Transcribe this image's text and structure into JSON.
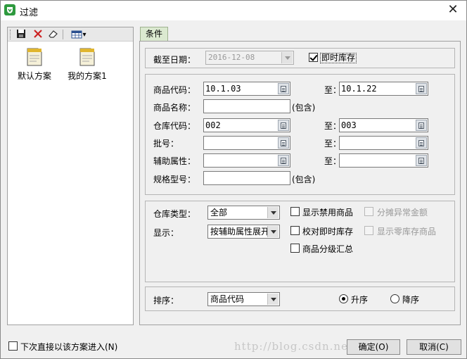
{
  "window": {
    "title": "过滤",
    "close": "✕"
  },
  "left": {
    "schemes": [
      {
        "label": "默认方案"
      },
      {
        "label": "我的方案1"
      }
    ],
    "toolbar": {
      "dropdown_arrow": "▾"
    }
  },
  "tab": {
    "label": "条件"
  },
  "date": {
    "label": "截至日期：",
    "value": "2016-12-08",
    "instant_stock_label": "即时库存",
    "instant_stock_checked": true
  },
  "filters": {
    "product_code_label": "商品代码：",
    "product_code_from": "10.1.03",
    "to_label": "至：",
    "product_code_to": "10.1.22",
    "product_name_label": "商品名称：",
    "contains_label": "(包含)",
    "warehouse_code_label": "仓库代码：",
    "warehouse_code_from": "002",
    "warehouse_code_to": "003",
    "batch_label": "批号：",
    "aux_attr_label": "辅助属性：",
    "spec_model_label": "规格型号："
  },
  "options": {
    "warehouse_type_label": "仓库类型：",
    "warehouse_type_value": "全部",
    "display_label": "显示：",
    "display_value": "按辅助属性展开",
    "show_disabled_label": "显示禁用商品",
    "check_instant_label": "校对即时库存",
    "category_summary_label": "商品分级汇总",
    "allocate_abnormal_label": "分摊异常金额",
    "show_zero_label": "显示零库存商品"
  },
  "sort": {
    "label": "排序：",
    "value": "商品代码",
    "asc_label": "升序",
    "desc_label": "降序",
    "selected": "asc"
  },
  "footer": {
    "enter_directly_label": "下次直接以该方案进入(N)",
    "ok_label": "确定(O)",
    "cancel_label": "取消(C)",
    "watermark": "http://blog.csdn.net/"
  },
  "colors": {
    "tab_bg": "#dbe9d0",
    "app_icon": "#2e9a3e",
    "delete_x": "#cc2222",
    "save_icon": "#222222"
  }
}
